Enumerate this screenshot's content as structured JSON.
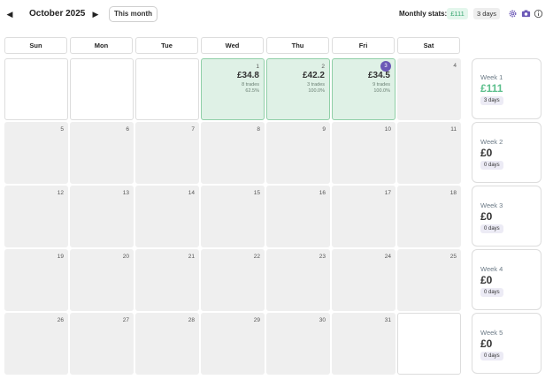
{
  "header": {
    "prev_icon": "triangle-left-icon",
    "next_icon": "triangle-right-icon",
    "month_title": "October 2025",
    "this_month_label": "This month",
    "stats_label": "Monthly stats:",
    "stats_pnl": "£111",
    "stats_days": "3 days",
    "icons": [
      "gear-icon",
      "camera-icon",
      "info-icon"
    ]
  },
  "weekdays": [
    "Sun",
    "Mon",
    "Tue",
    "Wed",
    "Thu",
    "Fri",
    "Sat"
  ],
  "days": [
    {
      "num": "",
      "blank": true
    },
    {
      "num": "",
      "blank": true
    },
    {
      "num": "",
      "blank": true
    },
    {
      "num": "1",
      "pnl": "£34.8",
      "trades": "8 trades",
      "winrate": "62.5%"
    },
    {
      "num": "2",
      "pnl": "£42.2",
      "trades": "3 trades",
      "winrate": "100.0%"
    },
    {
      "num": "3",
      "today": true,
      "pnl": "£34.5",
      "trades": "9 trades",
      "winrate": "100.0%"
    },
    {
      "num": "4"
    },
    {
      "num": "5"
    },
    {
      "num": "6"
    },
    {
      "num": "7"
    },
    {
      "num": "8"
    },
    {
      "num": "9"
    },
    {
      "num": "10"
    },
    {
      "num": "11"
    },
    {
      "num": "12"
    },
    {
      "num": "13"
    },
    {
      "num": "14"
    },
    {
      "num": "15"
    },
    {
      "num": "16"
    },
    {
      "num": "17"
    },
    {
      "num": "18"
    },
    {
      "num": "19"
    },
    {
      "num": "20"
    },
    {
      "num": "21"
    },
    {
      "num": "22"
    },
    {
      "num": "23"
    },
    {
      "num": "24"
    },
    {
      "num": "25"
    },
    {
      "num": "26"
    },
    {
      "num": "27"
    },
    {
      "num": "28"
    },
    {
      "num": "29"
    },
    {
      "num": "30"
    },
    {
      "num": "31"
    },
    {
      "num": "",
      "blank": true
    }
  ],
  "weeks": [
    {
      "title": "Week 1",
      "value": "£111",
      "days": "3 days",
      "positive": true
    },
    {
      "title": "Week 2",
      "value": "£0",
      "days": "0 days",
      "positive": false
    },
    {
      "title": "Week 3",
      "value": "£0",
      "days": "0 days",
      "positive": false
    },
    {
      "title": "Week 4",
      "value": "£0",
      "days": "0 days",
      "positive": false
    },
    {
      "title": "Week 5",
      "value": "£0",
      "days": "0 days",
      "positive": false
    }
  ],
  "colors": {
    "trade_cell_bg": "#dff1e6",
    "trade_cell_border": "#8fcfa7",
    "empty_cell_bg": "#efefef",
    "positive_text": "#5cbf8c",
    "today_badge": "#6b58b6"
  }
}
